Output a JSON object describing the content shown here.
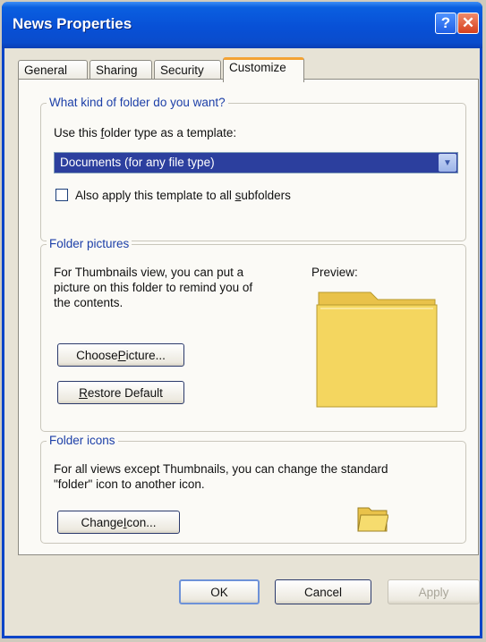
{
  "window": {
    "title": "News Properties",
    "help_glyph": "?",
    "close_glyph": "✕"
  },
  "tabs": [
    {
      "label": "General"
    },
    {
      "label": "Sharing"
    },
    {
      "label": "Security"
    },
    {
      "label": "Customize",
      "active": true
    }
  ],
  "folder_type": {
    "legend": "What kind of folder do you want?",
    "use_label_pre": "Use this ",
    "use_label_u": "f",
    "use_label_post": "older type as a template:",
    "selected": "Documents (for any file type)",
    "apply_pre": "Also apply this template to all ",
    "apply_u": "s",
    "apply_post": "ubfolders",
    "apply_checked": false
  },
  "folder_pictures": {
    "legend": "Folder pictures",
    "desc_line1": "For Thumbnails view, you can put a",
    "desc_line2": "picture on this folder to remind you of",
    "desc_line3": "the contents.",
    "preview_label": "Preview:",
    "choose_pre": "Choose ",
    "choose_u": "P",
    "choose_post": "icture...",
    "restore_u": "R",
    "restore_post": "estore Default"
  },
  "folder_icons": {
    "legend": "Folder icons",
    "desc_line1": "For all views except Thumbnails, you can change the standard",
    "desc_line2": "\"folder\" icon to another icon.",
    "change_pre": "Change ",
    "change_u": "I",
    "change_post": "con..."
  },
  "buttons": {
    "ok": "OK",
    "cancel": "Cancel",
    "apply": "Apply"
  },
  "icons": {
    "folder_preview": "folder-icon",
    "folder_small": "folder-icon",
    "dropdown": "chevron-down-icon"
  },
  "colors": {
    "titlebar": "#0a5fe0",
    "selection": "#2c3f9e",
    "legend_text": "#1c3fa8",
    "active_tab_accent": "#f3a233",
    "folder_yellow": "#f3d35c"
  }
}
